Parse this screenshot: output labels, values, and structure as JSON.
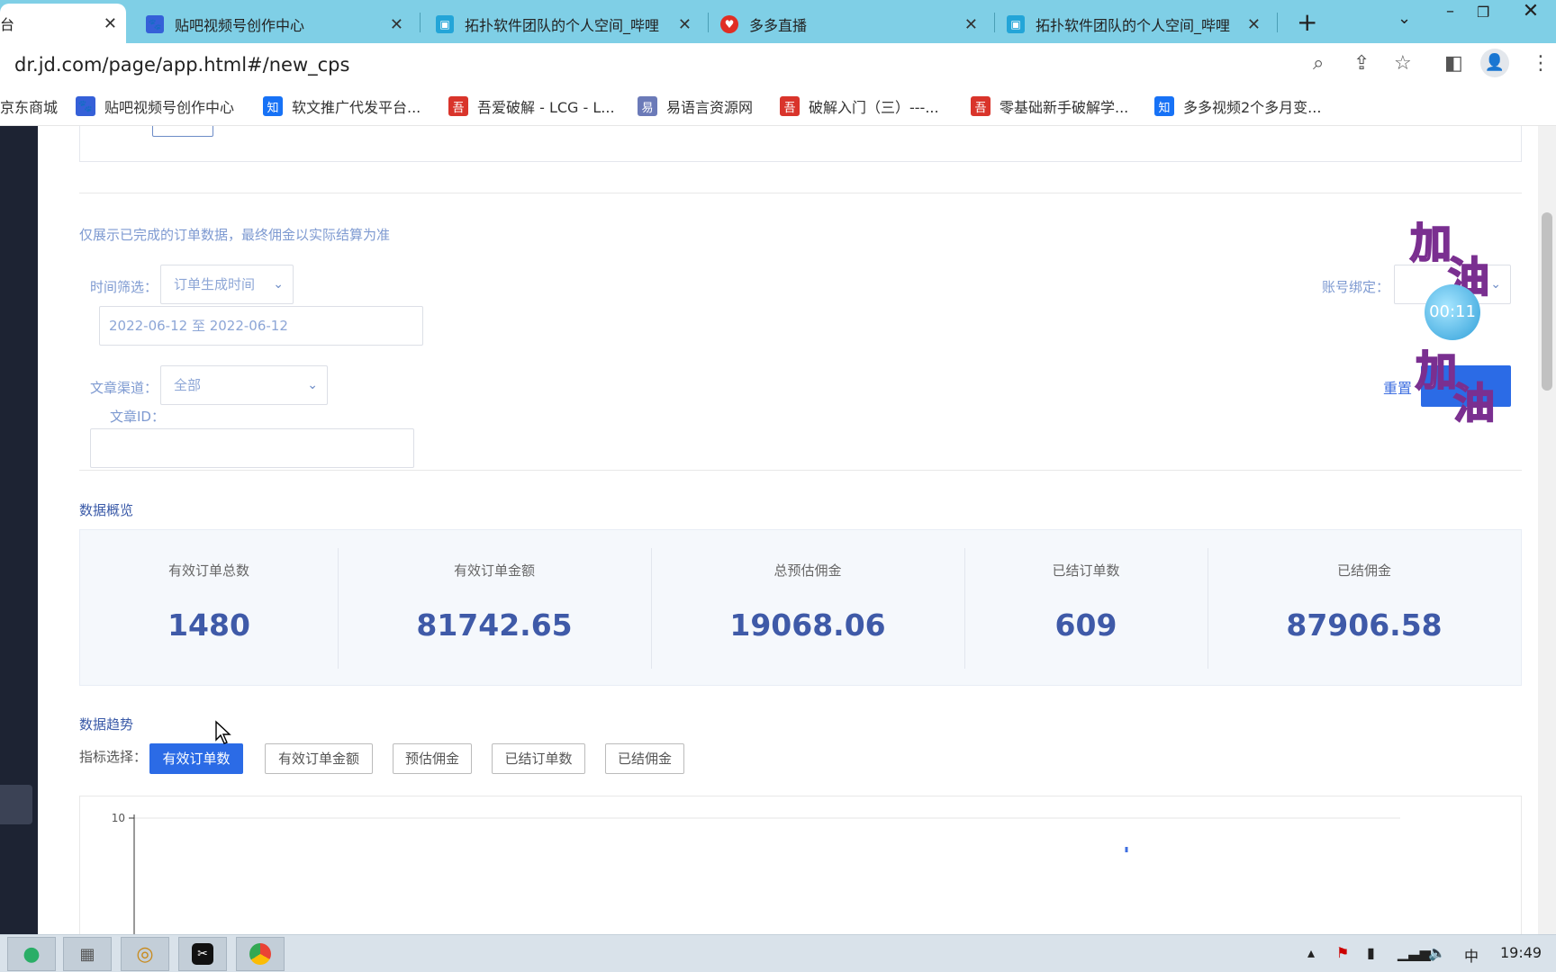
{
  "browser": {
    "tabs": [
      {
        "title": "台",
        "close": "✕",
        "icon": "",
        "icon_color": "#ffffff"
      },
      {
        "title": "贴吧视频号创作中心",
        "close": "✕",
        "icon": "paw-icon",
        "icon_color": "#3560d8"
      },
      {
        "title": "拓扑软件团队的个人空间_哔哩",
        "close": "✕",
        "icon": "bilibili-icon",
        "icon_color": "#23a5d8"
      },
      {
        "title": "多多直播",
        "close": "✕",
        "icon": "pinduoduo-icon",
        "icon_color": "#e02e24"
      },
      {
        "title": "拓扑软件团队的个人空间_哔哩",
        "close": "✕",
        "icon": "bilibili-icon",
        "icon_color": "#23a5d8"
      }
    ],
    "new_tab": "+",
    "url": "dr.jd.com/page/app.html#/new_cps",
    "bookmarks": [
      {
        "label": "京东商城",
        "icon": "",
        "color": "#ffffff"
      },
      {
        "label": "贴吧视频号创作中心",
        "icon": "paw-icon",
        "color": "#3560d8"
      },
      {
        "label": "软文推广代发平台...",
        "icon": "zhihu-icon",
        "color": "#1772f6"
      },
      {
        "label": "吾爱破解 - LCG - L...",
        "icon": "52pojie-icon",
        "color": "#d9342b"
      },
      {
        "label": "易语言资源网",
        "icon": "site-icon",
        "color": "#6b7ab8"
      },
      {
        "label": "破解入门（三）---...",
        "icon": "52pojie-icon",
        "color": "#d9342b"
      },
      {
        "label": "零基础新手破解学...",
        "icon": "52pojie-icon",
        "color": "#d9342b"
      },
      {
        "label": "多多视频2个多月变...",
        "icon": "zhihu-icon",
        "color": "#1772f6"
      }
    ]
  },
  "filters": {
    "notice": "仅展示已完成的订单数据，最终佣金以实际结算为准",
    "time_label": "时间筛选：",
    "time_value": "订单生成时间",
    "date_range": "2022-06-12 至 2022-06-12",
    "channel_label": "文章渠道：",
    "channel_value": "全部",
    "article_id_label": "文章ID：",
    "account_label": "账号绑定：",
    "reset": "重置"
  },
  "overlay": {
    "sticker_text_1": "加",
    "sticker_text_2": "油",
    "timer": "00:11"
  },
  "overview": {
    "title": "数据概览",
    "stats": [
      {
        "label": "有效订单总数",
        "value": "1480"
      },
      {
        "label": "有效订单金额",
        "value": "81742.65"
      },
      {
        "label": "总预估佣金",
        "value": "19068.06"
      },
      {
        "label": "已结订单数",
        "value": "609"
      },
      {
        "label": "已结佣金",
        "value": "87906.58"
      }
    ]
  },
  "trend": {
    "title": "数据趋势",
    "metric_label": "指标选择：",
    "metrics": [
      "有效订单数",
      "有效订单金额",
      "预估佣金",
      "已结订单数",
      "已结佣金"
    ],
    "active_index": 0,
    "y_tick_top": "10"
  },
  "taskbar": {
    "ime": "中",
    "time": "19:49"
  },
  "colors": {
    "accent": "#2b6be6",
    "value_text": "#3f5aa8",
    "label_blue": "#7e9ad1"
  }
}
